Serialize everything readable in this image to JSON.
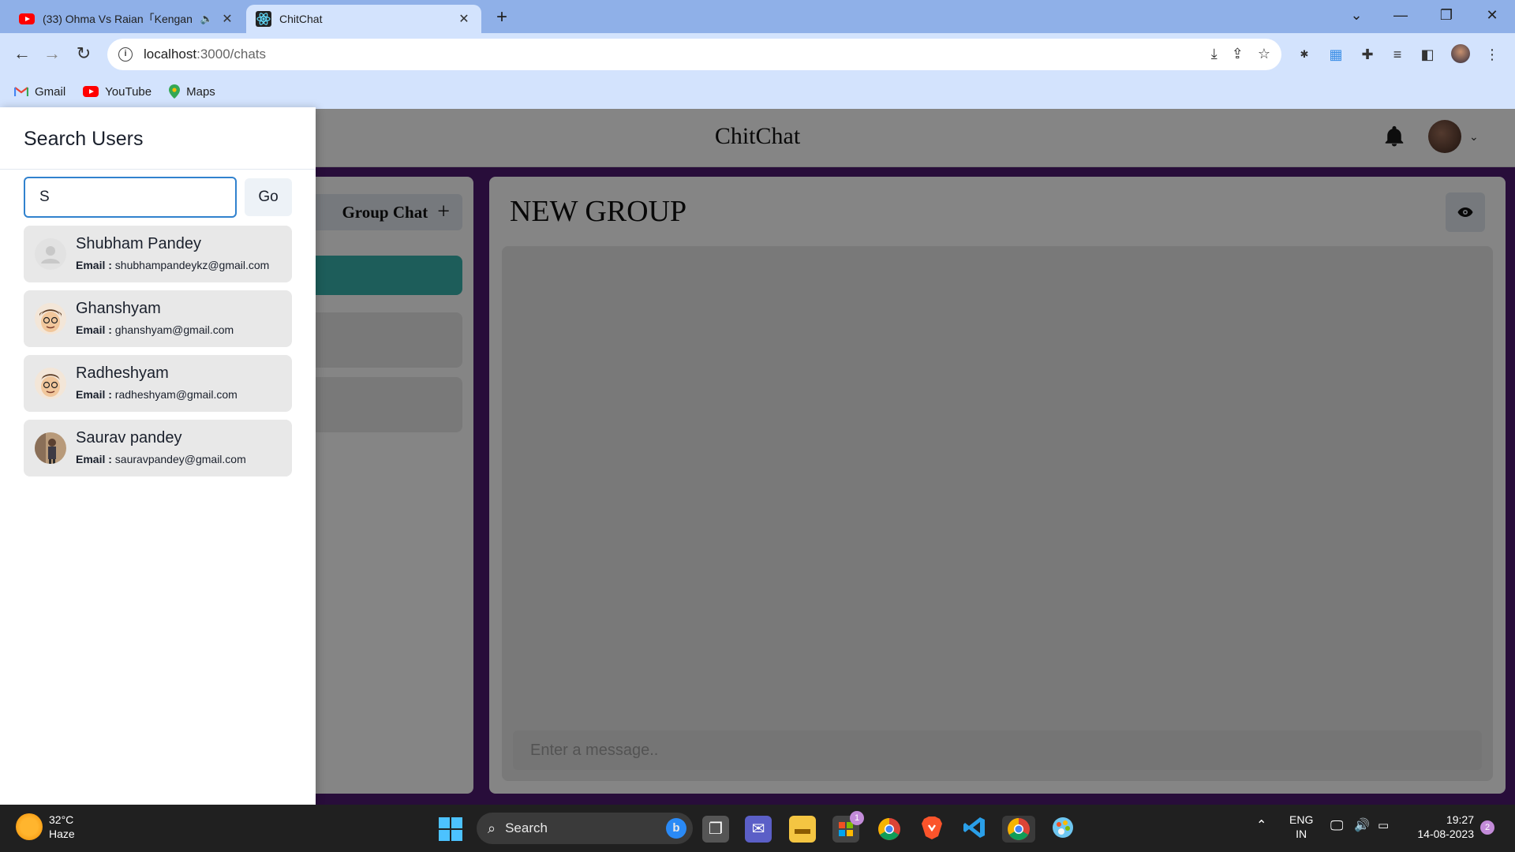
{
  "browser": {
    "tabs": [
      {
        "title": "(33) Ohma Vs Raian「Kengan",
        "active": false
      },
      {
        "title": "ChitChat",
        "active": true
      }
    ],
    "address": {
      "host": "localhost",
      "path": ":3000/chats"
    },
    "bookmarks": [
      "Gmail",
      "YouTube",
      "Maps"
    ]
  },
  "app": {
    "title": "ChitChat",
    "group_chat_button": "Group Chat",
    "chat_name": "NEW GROUP",
    "message_placeholder": "Enter a message.."
  },
  "drawer": {
    "title": "Search Users",
    "search_value": "S",
    "go_label": "Go",
    "email_label": "Email :",
    "results": [
      {
        "name": "Shubham Pandey",
        "email": "shubhampandeykz@gmail.com"
      },
      {
        "name": "Ghanshyam",
        "email": "ghanshyam@gmail.com"
      },
      {
        "name": "Radheshyam",
        "email": "radheshyam@gmail.com"
      },
      {
        "name": "Saurav pandey",
        "email": "sauravpandey@gmail.com"
      }
    ]
  },
  "taskbar": {
    "weather_temp": "32°C",
    "weather_desc": "Haze",
    "search_label": "Search",
    "store_badge": "1",
    "lang_line1": "ENG",
    "lang_line2": "IN",
    "time": "19:27",
    "date": "14-08-2023",
    "notification_count": "2"
  },
  "colors": {
    "app_background": "#4d1a6f",
    "selected_chat": "#38b2ac",
    "search_focus": "#3182ce",
    "tab_strip": "#8fb0e8",
    "toolbar": "#d3e3fd"
  }
}
